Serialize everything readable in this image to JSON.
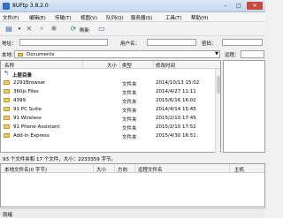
{
  "window": {
    "title": "8UFtp 3.8.2.0",
    "min": "–",
    "max": "□",
    "close": "✕"
  },
  "menu": [
    "文件(F)",
    "编辑(E)",
    "传输(T)",
    "视图(V)",
    "队列(Q)",
    "服务器(S)",
    "工具(T)",
    "帮助(H)"
  ],
  "toolbar": {
    "refresh_label": "刷新"
  },
  "connection": {
    "address_label": "地址：",
    "user_label": "用户名：",
    "password_label": "密码："
  },
  "local": {
    "path_label": "本地：",
    "path_value": "Documents",
    "columns": [
      "名称",
      "大小",
      "类型",
      "修改时间"
    ],
    "up_label": "上层目录",
    "rows": [
      {
        "name": "2291Browser",
        "type": "文件夹",
        "date": "2014/10/13 15:02"
      },
      {
        "name": "360js Files",
        "type": "文件夹",
        "date": "2014/4/27 11:11"
      },
      {
        "name": "4399",
        "type": "文件夹",
        "date": "2015/6/16 16:02"
      },
      {
        "name": "91 PC Suite",
        "type": "文件夹",
        "date": "2014/4/14 15:45"
      },
      {
        "name": "91 Wireless",
        "type": "文件夹",
        "date": "2015/2/10 17:45"
      },
      {
        "name": "91 Phone Assistant",
        "type": "文件夹",
        "date": "2015/2/10 17:52"
      },
      {
        "name": "Add-in Express",
        "type": "文件夹",
        "date": "2015/4/30 16:51"
      }
    ],
    "status": "93 个文件夹和 17 个文件，大小：2233359 字节。"
  },
  "remote": {
    "path_label": "远程："
  },
  "queue": {
    "columns": [
      "本地文件名(0 字节)",
      "大小",
      "方向",
      "远程文件名",
      "主机"
    ]
  },
  "statusbar": {
    "text": "就绪"
  }
}
